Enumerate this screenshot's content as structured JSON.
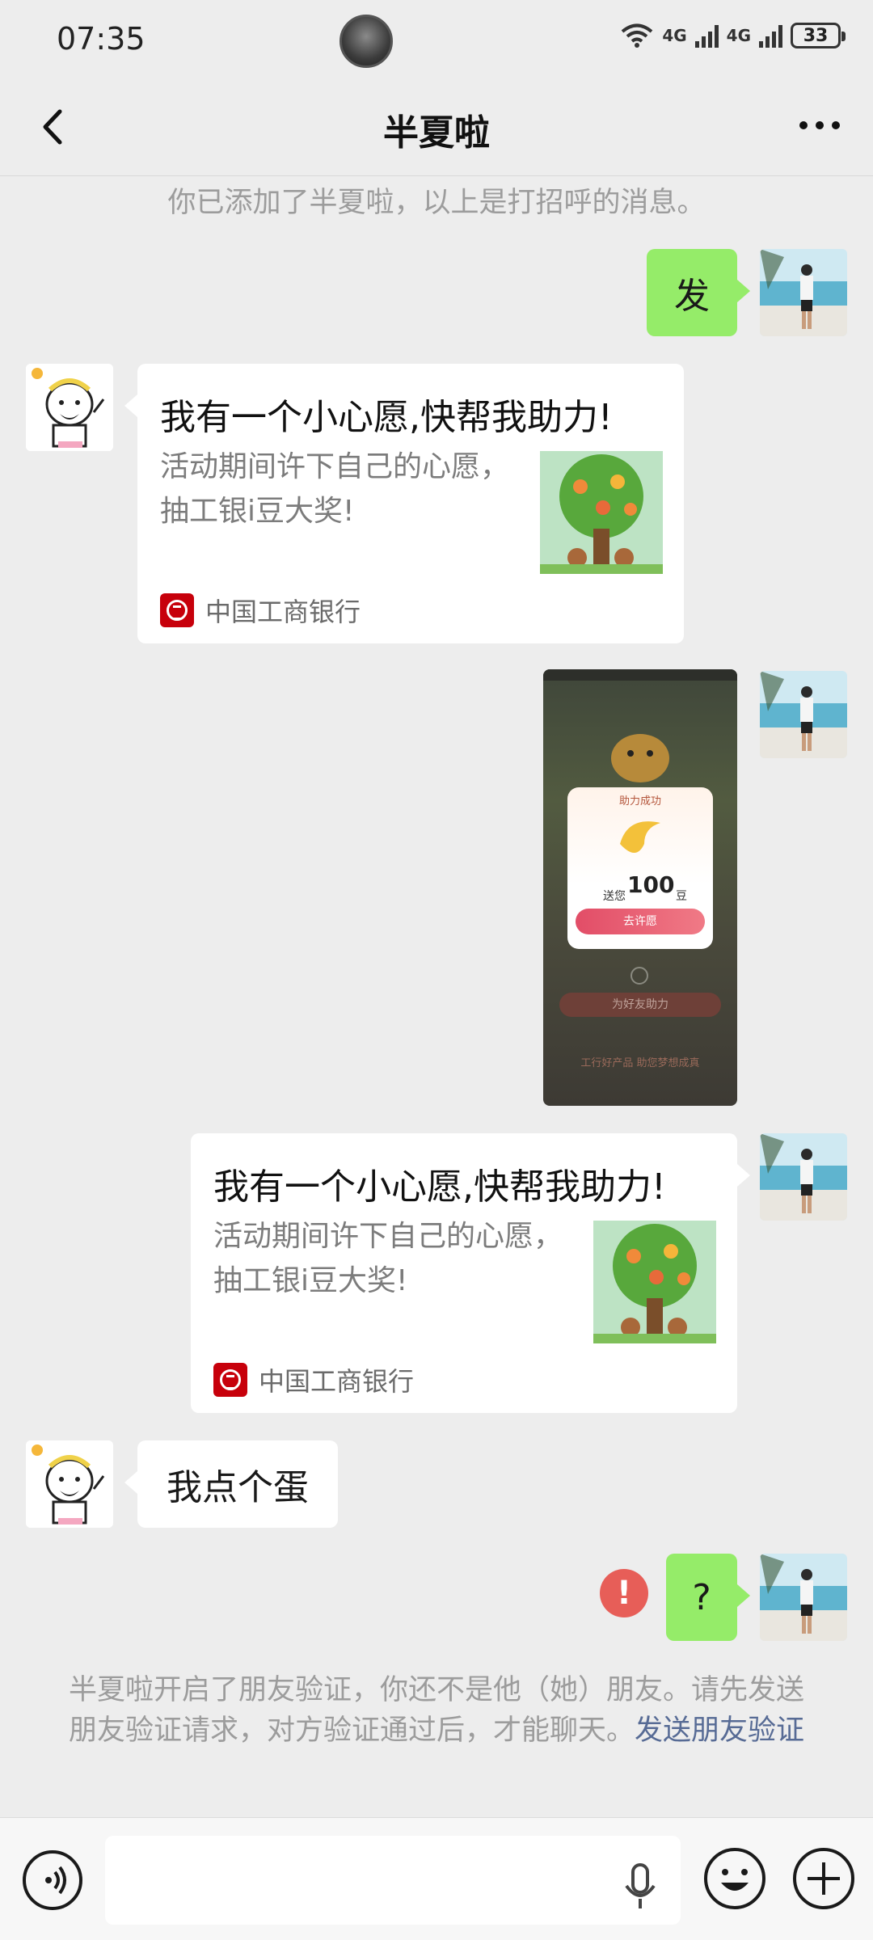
{
  "status_bar": {
    "time": "07:35",
    "network_1": "4G",
    "network_2": "4G",
    "battery": "33"
  },
  "nav": {
    "title": "半夏啦"
  },
  "chat": {
    "notice_top": "你已添加了半夏啦，以上是打招呼的消息。",
    "messages": [
      {
        "text": "发"
      },
      {
        "card_title": "我有一个小心愿,快帮我助力!",
        "card_desc": "活动期间许下自己的心愿，抽工银i豆大奖!",
        "card_source": "中国工商银行"
      },
      {
        "screenshot": {
          "popup_title": "助力成功",
          "amount_label": "送您",
          "amount": "100",
          "amount_unit": "豆",
          "popup_button": "去许愿",
          "help_button": "为好友助力",
          "footer": "工行好产品 助您梦想成真"
        }
      },
      {
        "card_title": "我有一个小心愿,快帮我助力!",
        "card_desc": "活动期间许下自己的心愿，抽工银i豆大奖!",
        "card_source": "中国工商银行"
      },
      {
        "text": "我点个蛋"
      },
      {
        "text": "?"
      }
    ],
    "notice_bottom": "半夏啦开启了朋友验证，你还不是他（她）朋友。请先发送朋友验证请求，对方验证通过后，才能聊天。",
    "notice_link": "发送朋友验证"
  },
  "input_bar": {
    "placeholder": ""
  },
  "colors": {
    "background": "#ededed",
    "my_bubble": "#95ec69",
    "their_bubble": "#ffffff",
    "link": "#576b95",
    "error": "#e75e58",
    "brand_icbc": "#c7000b"
  }
}
